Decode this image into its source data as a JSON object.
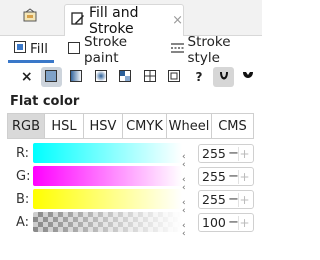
{
  "dock": {
    "first_tab_icon": "document-properties-icon",
    "active_tab": {
      "icon": "fill-and-stroke-icon",
      "title": "Fill and Stroke",
      "close_glyph": "×"
    }
  },
  "sub_tabs": [
    {
      "label": "Fill",
      "icon": "fill-icon",
      "active": true
    },
    {
      "label": "Stroke paint",
      "icon": "stroke-paint-icon",
      "active": false
    },
    {
      "label": "Stroke style",
      "icon": "stroke-style-icon",
      "active": false
    }
  ],
  "paint_types": [
    {
      "glyph": "×",
      "name": "no-paint-icon"
    },
    {
      "glyph": "",
      "name": "flat-color-icon",
      "selected": true
    },
    {
      "glyph": "",
      "name": "linear-gradient-icon"
    },
    {
      "glyph": "",
      "name": "radial-gradient-icon"
    },
    {
      "glyph": "",
      "name": "mesh-gradient-icon"
    },
    {
      "glyph": "",
      "name": "pattern-icon"
    },
    {
      "glyph": "",
      "name": "swatch-icon"
    },
    {
      "glyph": "?",
      "name": "unset-paint-icon"
    },
    {
      "glyph": "",
      "name": "fill-rule-evenodd-icon",
      "selected": true
    },
    {
      "glyph": "",
      "name": "fill-rule-nonzero-icon"
    }
  ],
  "section_label": "Flat color",
  "color_models": [
    {
      "label": "RGB",
      "selected": true
    },
    {
      "label": "HSL"
    },
    {
      "label": "HSV"
    },
    {
      "label": "CMYK"
    },
    {
      "label": "Wheel"
    },
    {
      "label": "CMS"
    }
  ],
  "channels": [
    {
      "label": "R:",
      "value": "255",
      "minus": "−",
      "plus": "+",
      "start_color": "#00ffff",
      "end_color": "#ffffff"
    },
    {
      "label": "G:",
      "value": "255",
      "minus": "−",
      "plus": "+",
      "start_color": "#ff00ff",
      "end_color": "#ffffff"
    },
    {
      "label": "B:",
      "value": "255",
      "minus": "−",
      "plus": "+",
      "start_color": "#ffff00",
      "end_color": "#ffffff"
    },
    {
      "label": "A:",
      "value": "100",
      "minus": "−",
      "plus": "+",
      "start_color": "checkerboard",
      "end_color": "#ffffff"
    }
  ],
  "accent_color": "#3a78c9"
}
